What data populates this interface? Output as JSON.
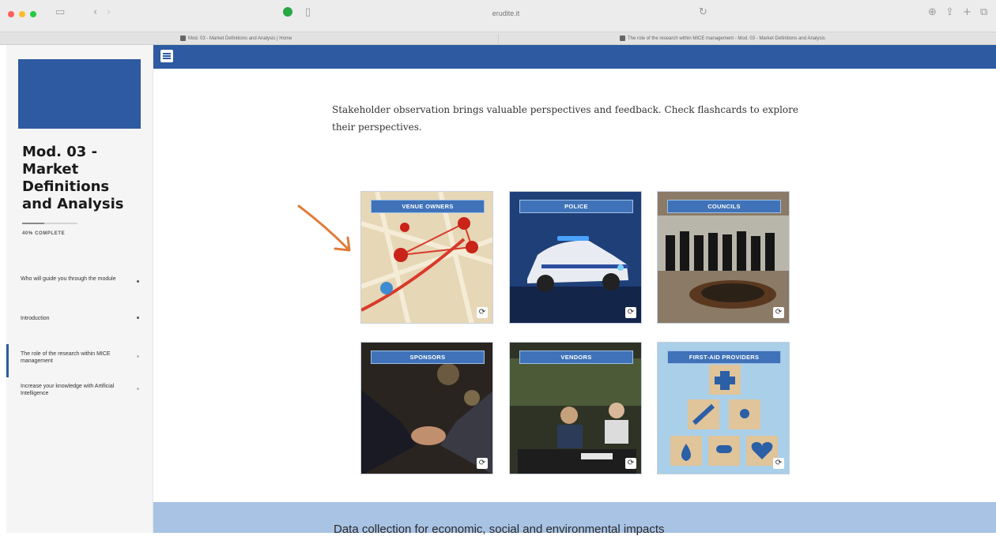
{
  "browser": {
    "url": "erudite.it",
    "tabs": [
      {
        "title": "Mod. 03 - Market Definitions and Analysis | Home"
      },
      {
        "title": "The role of the research within MICE management - Mod. 03 - Market Definitions and Analysis"
      }
    ],
    "icons": {
      "back": "back-arrow-icon",
      "sidebar_toggle": "sidebar-icon",
      "shield": "shield-icon",
      "share": "share-icon",
      "new_tab": "plus-icon",
      "tabs": "tabs-overview-icon"
    }
  },
  "sidebar": {
    "title": "Mod. 03 - Market Definitions and Analysis",
    "progress_label": "40% COMPLETE",
    "progress_fraction": 0.4,
    "items": [
      {
        "label": "Who will guide you through the module"
      },
      {
        "label": "Introduction"
      },
      {
        "label": "The role of the research within MICE management"
      },
      {
        "label": "Increase your knowledge with Artificial Intelligence"
      }
    ]
  },
  "main": {
    "intro": "Stakeholder observation brings valuable perspectives and feedback. Check flashcards to explore their perspectives.",
    "cards": [
      {
        "label": "VENUE OWNERS"
      },
      {
        "label": "POLICE"
      },
      {
        "label": "COUNCILS"
      },
      {
        "label": "SPONSORS"
      },
      {
        "label": "VENDORS"
      },
      {
        "label": "FIRST-AID PROVIDERS"
      }
    ],
    "flip_icon": "⟳",
    "next_section": "Data collection for economic, social and environmental impacts"
  },
  "colors": {
    "brand_blue": "#2d5aa0",
    "band_blue": "#a8c3e4",
    "arrow_orange": "#e07b39"
  }
}
